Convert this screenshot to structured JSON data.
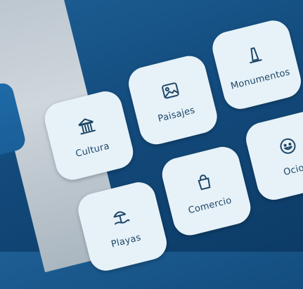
{
  "categories": [
    {
      "label": "Cultura",
      "icon": "museum-icon"
    },
    {
      "label": "Paisajes",
      "icon": "landscape-image-icon"
    },
    {
      "label": "Monumentos",
      "icon": "monument-icon"
    },
    {
      "label": "Playas",
      "icon": "beach-umbrella-icon"
    },
    {
      "label": "Comercio",
      "icon": "shopping-bag-icon"
    },
    {
      "label": "Ocio",
      "icon": "smiley-face-icon"
    }
  ]
}
